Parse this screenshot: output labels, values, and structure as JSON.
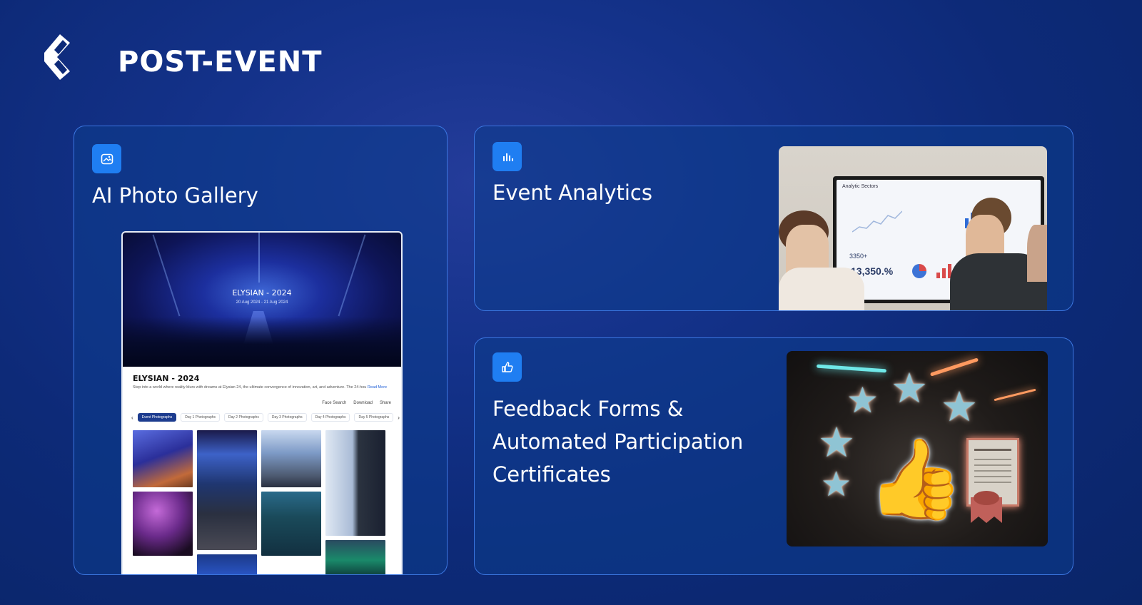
{
  "header": {
    "title": "POST-EVENT"
  },
  "cards": {
    "gallery": {
      "title": "AI Photo Gallery",
      "icon": "image-icon",
      "screenshot": {
        "hero_title": "ELYSIAN - 2024",
        "hero_date": "20 Aug 2024 - 21 Aug 2024",
        "event_title": "ELYSIAN - 2024",
        "description": "Step into a world where reality blurs with dreams at Elysian 24, the ultimate convergence of innovation, art, and adventure. The 24-hou",
        "read_more": "Read More",
        "actions": [
          "Face Search",
          "Download",
          "Share"
        ],
        "tabs": [
          "Event Photographs",
          "Day 1 Photographs",
          "Day 2 Photographs",
          "Day 3 Photographs",
          "Day 4 Photographs",
          "Day 5 Photographs"
        ]
      }
    },
    "analytics": {
      "title": "Event Analytics",
      "icon": "bar-chart-icon",
      "screen": {
        "header": "Analytic Sectors",
        "stat_small": "3350+",
        "stat_large": "13,350.%"
      }
    },
    "feedback": {
      "title": "Feedback Forms & Automated Participation Certificates",
      "icon": "thumbs-up-icon"
    }
  },
  "colors": {
    "background": "#0d2a78",
    "card_border": "#3b76e0",
    "icon_bg": "#1f7ef2",
    "tab_active": "#1d3c8f"
  }
}
